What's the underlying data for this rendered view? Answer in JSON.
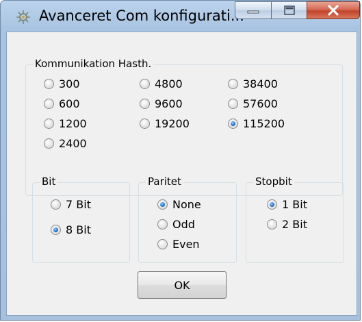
{
  "window": {
    "title": "Avanceret Com konfigurati...",
    "icon": "network-gear-icon"
  },
  "caption_buttons": {
    "minimize_icon": "minimize-icon",
    "maximize_icon": "maximize-icon",
    "close_icon": "close-icon",
    "close_color": "#c2412a"
  },
  "speed_group": {
    "label": "Kommunikation Hasth.",
    "options": [
      "300",
      "600",
      "1200",
      "2400",
      "4800",
      "9600",
      "19200",
      "38400",
      "57600",
      "115200"
    ],
    "selected": "115200"
  },
  "bit_group": {
    "label": "Bit",
    "options": [
      "7 Bit",
      "8 Bit"
    ],
    "selected": "8 Bit"
  },
  "parity_group": {
    "label": "Paritet",
    "options": [
      "None",
      "Odd",
      "Even"
    ],
    "selected": "None"
  },
  "stopbit_group": {
    "label": "Stopbit",
    "options": [
      "1 Bit",
      "2 Bit"
    ],
    "selected": "1 Bit"
  },
  "ok_button": {
    "label": "OK"
  }
}
